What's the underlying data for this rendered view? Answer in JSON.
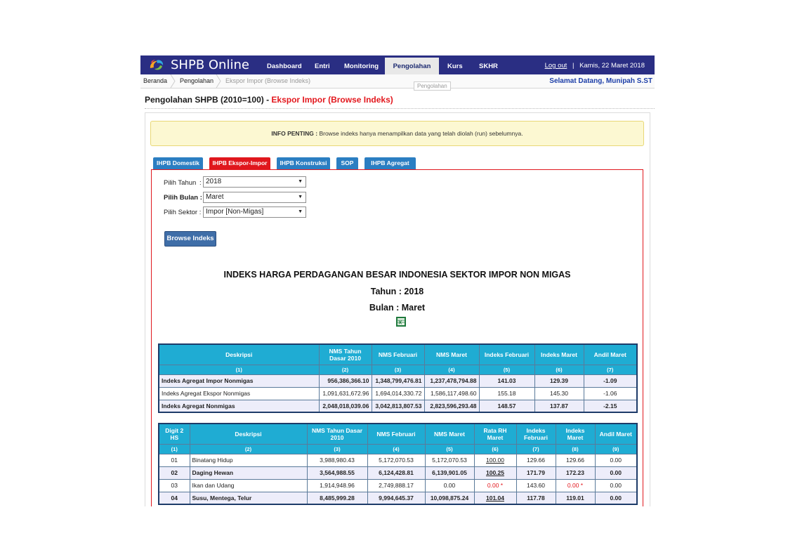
{
  "app": {
    "title": "SHPB Online",
    "logo_icon": "swirl-logo-icon"
  },
  "nav": {
    "items": [
      {
        "label": "Dashboard"
      },
      {
        "label": "Entri"
      },
      {
        "label": "Monitoring"
      },
      {
        "label": "Pengolahan",
        "active": true
      },
      {
        "label": "Kurs"
      },
      {
        "label": "SKHR"
      }
    ],
    "logout": "Log out",
    "separator": "|",
    "date": "Kamis, 22 Maret 2018"
  },
  "breadcrumb": {
    "items": [
      "Beranda",
      "Pengolahan",
      "Ekspor Impor (Browse Indeks)"
    ],
    "tooltip": "Pengolahan"
  },
  "welcome": "Selamat Datang, Munipah S.ST",
  "page": {
    "title_prefix": "Pengolahan SHPB (2010=100) - ",
    "title_accent": "Ekspor Impor (Browse Indeks)"
  },
  "info": {
    "label": "INFO PENTING :",
    "text": "Browse indeks hanya menampilkan data yang telah diolah (run) sebelumnya."
  },
  "tabs": [
    {
      "label": "IHPB Domestik"
    },
    {
      "label": "IHPB Ekspor-Impor",
      "active": true
    },
    {
      "label": "IHPB Konstruksi"
    },
    {
      "label": "SOP"
    },
    {
      "label": "IHPB Agregat"
    }
  ],
  "form": {
    "tahun": {
      "label": "Pilih Tahun",
      "sep": ":",
      "value": "2018"
    },
    "bulan": {
      "label": "Pilih Bulan",
      "sep": ":",
      "value": "Maret"
    },
    "sektor": {
      "label": "Pilih Sektor",
      "sep": ":",
      "value": "Impor [Non-Migas]"
    },
    "button": "Browse Indeks"
  },
  "report": {
    "title": "INDEKS HARGA PERDAGANGAN BESAR INDONESIA SEKTOR IMPOR NON MIGAS",
    "tahun": "Tahun : 2018",
    "bulan": "Bulan : Maret",
    "excel_icon": "excel-export-icon"
  },
  "table1": {
    "headers": [
      "Deskripsi",
      "NMS Tahun Dasar 2010",
      "NMS Februari",
      "NMS Maret",
      "Indeks Februari",
      "Indeks Maret",
      "Andil Maret"
    ],
    "numbers": [
      "(1)",
      "(2)",
      "(3)",
      "(4)",
      "(5)",
      "(6)",
      "(7)"
    ],
    "rows": [
      {
        "desc": "Indeks Agregat Impor Nonmigas",
        "nms2010": "956,386,366.10",
        "nmsfeb": "1,348,799,476.81",
        "nmsmar": "1,237,478,794.88",
        "idxfeb": "141.03",
        "idxmar": "129.39",
        "andil": "-1.09",
        "bold": true
      },
      {
        "desc": "Indeks Agregat Ekspor Nonmigas",
        "nms2010": "1,091,631,672.96",
        "nmsfeb": "1,694,014,330.72",
        "nmsmar": "1,586,117,498.60",
        "idxfeb": "155.18",
        "idxmar": "145.30",
        "andil": "-1.06",
        "bold": false
      },
      {
        "desc": "Indeks Agregat Nonmigas",
        "nms2010": "2,048,018,039.06",
        "nmsfeb": "3,042,813,807.53",
        "nmsmar": "2,823,596,293.48",
        "idxfeb": "148.57",
        "idxmar": "137.87",
        "andil": "-2.15",
        "bold": true
      }
    ]
  },
  "table2": {
    "headers": [
      "Digit 2 HS",
      "Deskripsi",
      "NMS Tahun Dasar 2010",
      "NMS Februari",
      "NMS Maret",
      "Rata RH Maret",
      "Indeks Februari",
      "Indeks Maret",
      "Andil Maret"
    ],
    "numbers": [
      "(1)",
      "(2)",
      "(3)",
      "(4)",
      "(5)",
      "(6)",
      "(7)",
      "(8)",
      "(9)"
    ],
    "rows": [
      {
        "hs": "01",
        "desc": "Binatang Hidup",
        "nms2010": "3,988,980.43",
        "nmsfeb": "5,172,070.53",
        "nmsmar": "5,172,070.53",
        "rata": "100.00",
        "idxfeb": "129.66",
        "idxmar": "129.66",
        "andil": "0.00",
        "bold": false,
        "flag": false
      },
      {
        "hs": "02",
        "desc": "Daging Hewan",
        "nms2010": "3,564,988.55",
        "nmsfeb": "6,124,428.81",
        "nmsmar": "6,139,901.05",
        "rata": "100.25",
        "idxfeb": "171.79",
        "idxmar": "172.23",
        "andil": "0.00",
        "bold": true,
        "flag": false
      },
      {
        "hs": "03",
        "desc": "Ikan dan Udang",
        "nms2010": "1,914,948.96",
        "nmsfeb": "2,749,888.17",
        "nmsmar": "0.00",
        "rata": "0.00 *",
        "idxfeb": "143.60",
        "idxmar": "0.00 *",
        "andil": "0.00",
        "bold": false,
        "flag": true
      },
      {
        "hs": "04",
        "desc": "Susu, Mentega, Telur",
        "nms2010": "8,485,999.28",
        "nmsfeb": "9,994,645.37",
        "nmsmar": "10,098,875.24",
        "rata": "101.04",
        "idxfeb": "117.78",
        "idxmar": "119.01",
        "andil": "0.00",
        "bold": true,
        "flag": false
      }
    ]
  },
  "colors": {
    "nav_bg": "#2a2e83",
    "accent_red": "#e3171d",
    "table_header": "#1facd3",
    "tab_blue": "#2b7ec2",
    "button_blue": "#3f6ea8",
    "info_bg": "#fcf8d2"
  }
}
